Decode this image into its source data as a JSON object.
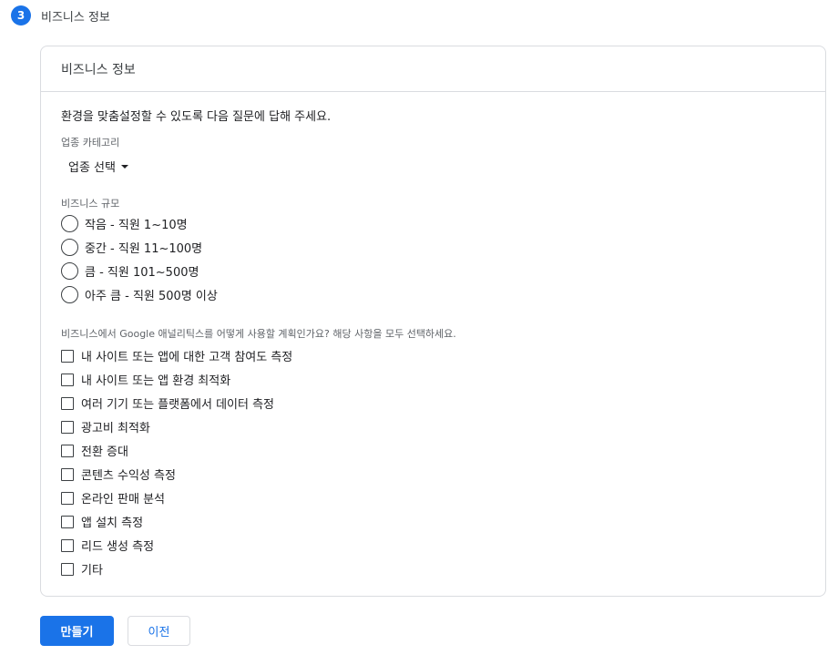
{
  "step": {
    "number": "3",
    "title": "비즈니스 정보"
  },
  "card": {
    "title": "비즈니스 정보",
    "intro": "환경을 맞춤설정할 수 있도록 다음 질문에 답해 주세요.",
    "industry": {
      "label": "업종 카테고리",
      "selected": "업종 선택"
    },
    "size": {
      "label": "비즈니스 규모",
      "options": [
        "작음 - 직원 1~10명",
        "중간 - 직원 11~100명",
        "큼 - 직원 101~500명",
        "아주 큼 - 직원 500명 이상"
      ]
    },
    "usage": {
      "label": "비즈니스에서 Google 애널리틱스를 어떻게 사용할 계획인가요? 해당 사항을 모두 선택하세요.",
      "options": [
        "내 사이트 또는 앱에 대한 고객 참여도 측정",
        "내 사이트 또는 앱 환경 최적화",
        "여러 기기 또는 플랫폼에서 데이터 측정",
        "광고비 최적화",
        "전환 증대",
        "콘텐츠 수익성 측정",
        "온라인 판매 분석",
        "앱 설치 측정",
        "리드 생성 측정",
        "기타"
      ]
    }
  },
  "buttons": {
    "create": "만들기",
    "back": "이전"
  },
  "colors": {
    "accent": "#1a73e8",
    "border": "#dadce0"
  }
}
